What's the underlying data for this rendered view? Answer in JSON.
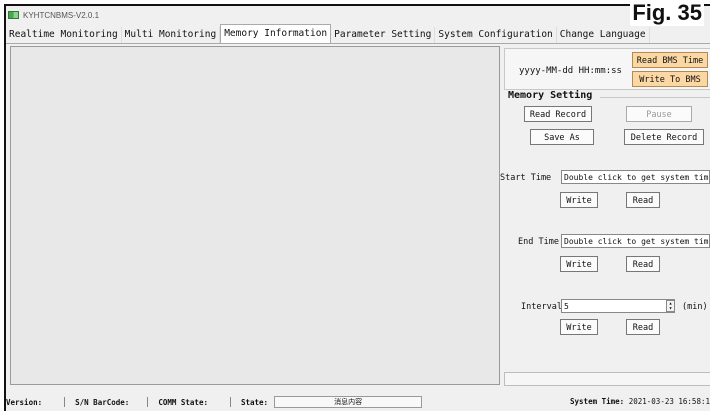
{
  "window": {
    "title": "KYHTCNBMS-V2.0.1",
    "figure_label": "Fig. 35"
  },
  "tabs": [
    {
      "label": "Realtime Monitoring"
    },
    {
      "label": "Multi Monitoring"
    },
    {
      "label": "Memory Information"
    },
    {
      "label": "Parameter Setting"
    },
    {
      "label": "System Configuration"
    },
    {
      "label": "Change Language"
    }
  ],
  "time_panel": {
    "datetime_format": "yyyy-MM-dd HH:mm:ss",
    "read_bms_time": "Read BMS Time",
    "write_to_bms": "Write To BMS"
  },
  "memory": {
    "title": "Memory Setting",
    "read_record": "Read Record",
    "pause": "Pause",
    "save_as": "Save As",
    "delete_record": "Delete Record",
    "start_time_label": "Start Time",
    "start_time_value": "Double click to get system time",
    "end_time_label": "End Time",
    "end_time_value": "Double click to get system time",
    "interval_label": "Interval",
    "interval_value": "5",
    "interval_unit": "(min)",
    "write": "Write",
    "read": "Read"
  },
  "status": {
    "version_label": "Version:",
    "sn_label": "S/N BarCode:",
    "comm_label": "COMM State:",
    "state_label": "State:",
    "state_value": "消息内容",
    "system_time_label": "System Time:",
    "system_time_value": "2021-03-23 16:58:1"
  },
  "colors": {
    "orange_button": "#fbd7a4",
    "panel_gray": "#e8e8e8",
    "background": "#f0f0f0"
  }
}
